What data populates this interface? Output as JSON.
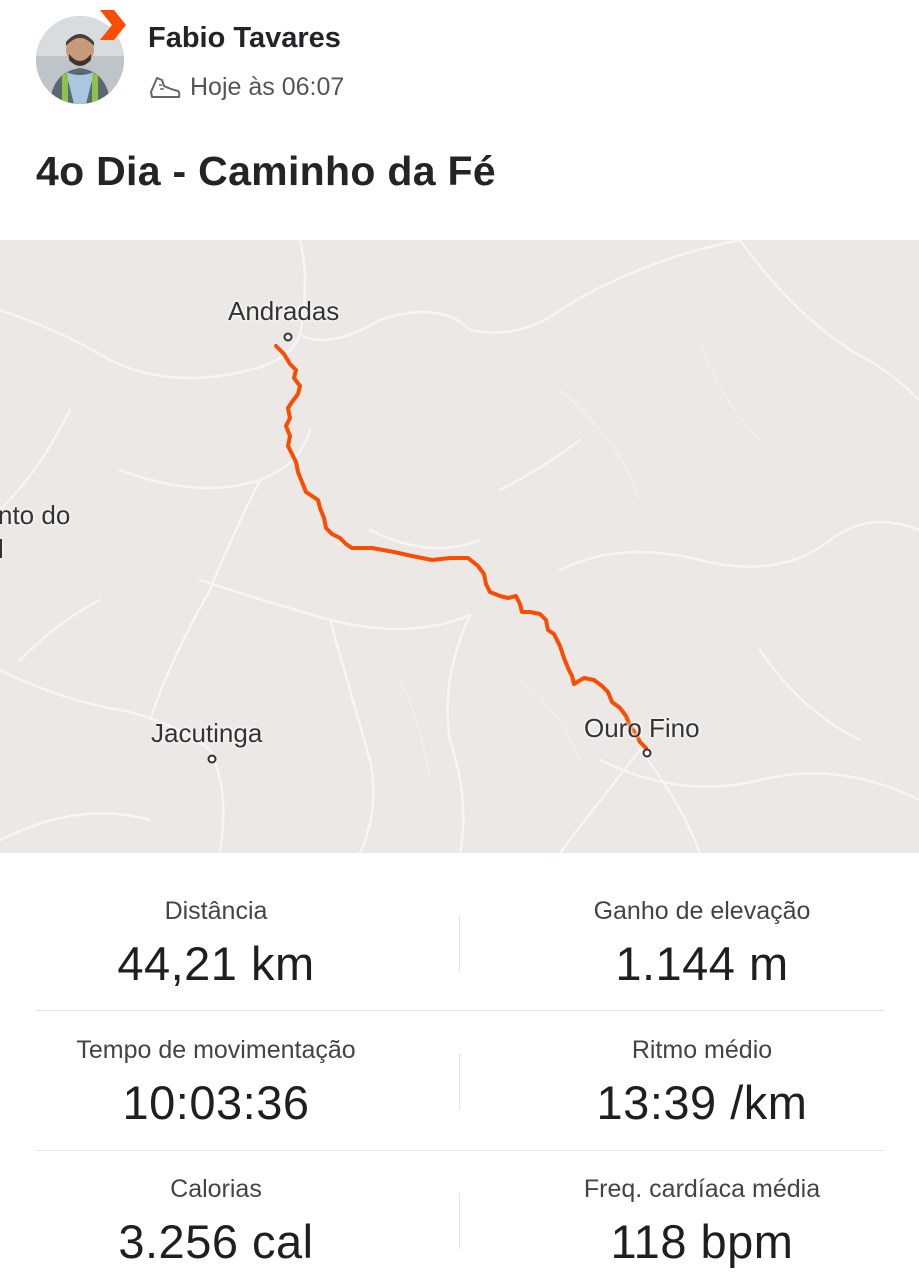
{
  "header": {
    "user_name": "Fabio Tavares",
    "timestamp": "Hoje às 06:07",
    "activity_icon": "walking-shoe-icon",
    "badge_icon": "strava-chevron-icon",
    "accent_color": "#fc4c02"
  },
  "activity": {
    "title": "4o Dia - Caminho da Fé"
  },
  "map": {
    "places": [
      "Andradas",
      "nto do",
      "l",
      "Jacutinga",
      "Ouro Fino"
    ],
    "route_color": "#fc4c02",
    "background_color": "#ebe8e6"
  },
  "stats": {
    "distance": {
      "label": "Distância",
      "value": "44,21 km"
    },
    "elevation": {
      "label": "Ganho de elevação",
      "value": "1.144 m"
    },
    "moving_time": {
      "label": "Tempo de movimentação",
      "value": "10:03:36"
    },
    "pace": {
      "label": "Ritmo médio",
      "value": "13:39 /km"
    },
    "calories": {
      "label": "Calorias",
      "value": "3.256 cal"
    },
    "heart_rate": {
      "label": "Freq. cardíaca média",
      "value": "118 bpm"
    }
  }
}
